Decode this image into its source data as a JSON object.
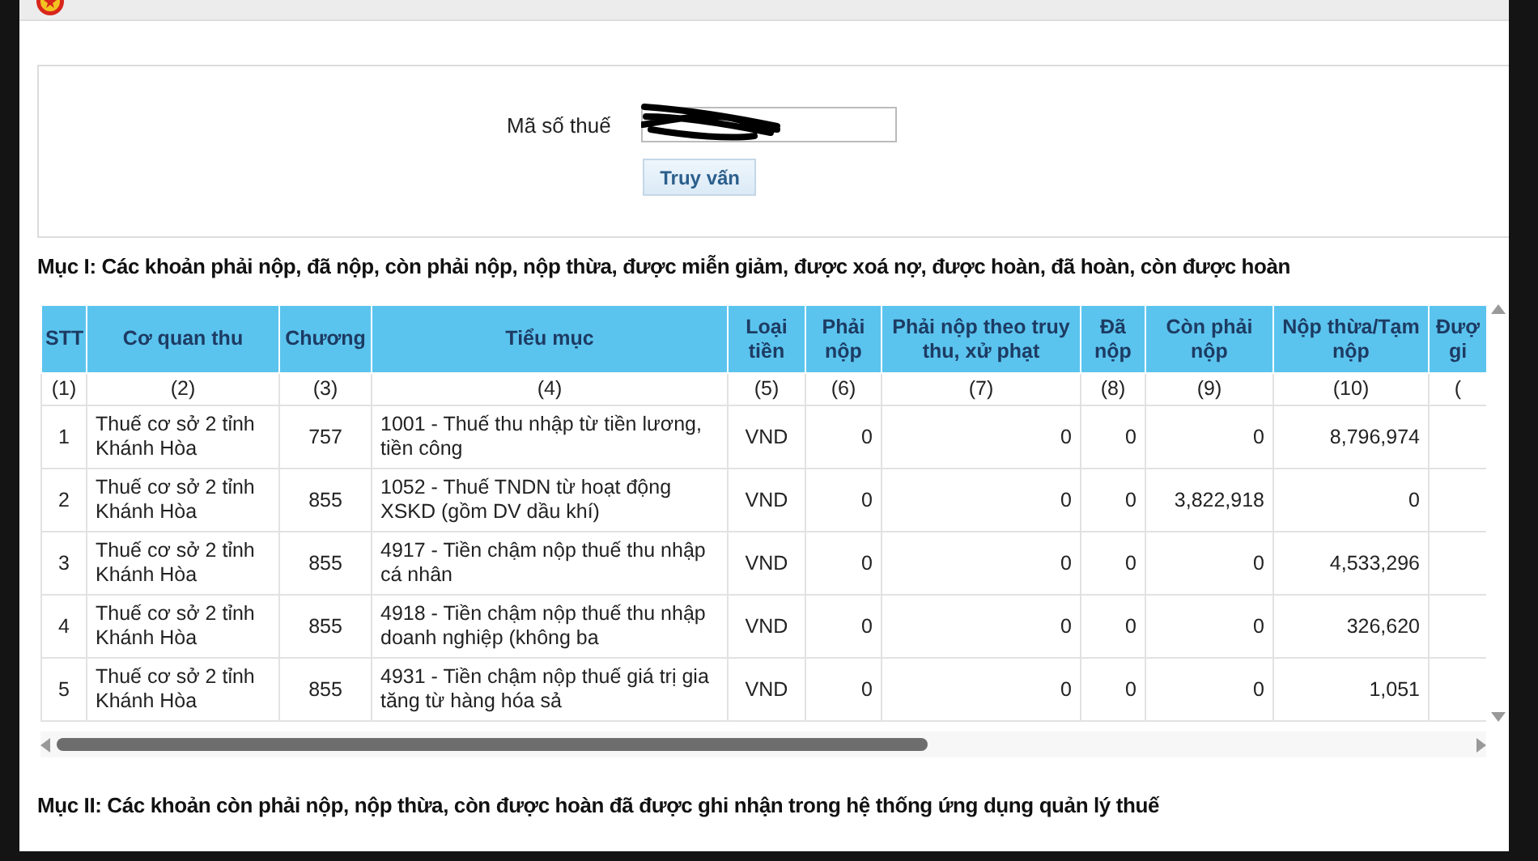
{
  "query_form": {
    "label": "Mã số thuế",
    "button": "Truy vấn"
  },
  "section_1": {
    "title": "Mục I: Các khoản phải nộp, đã nộp, còn phải nộp, nộp thừa, được miễn giảm, được xoá nợ, được hoàn, đã hoàn, còn được hoàn",
    "table": {
      "columns": [
        {
          "label": "STT",
          "number": "(1)"
        },
        {
          "label": "Cơ quan thu",
          "number": "(2)"
        },
        {
          "label": "Chương",
          "number": "(3)"
        },
        {
          "label": "Tiểu mục",
          "number": "(4)"
        },
        {
          "label": "Loại tiền",
          "number": "(5)"
        },
        {
          "label": "Phải nộp",
          "number": "(6)"
        },
        {
          "label": "Phải nộp theo truy thu, xử phạt",
          "number": "(7)"
        },
        {
          "label": "Đã nộp",
          "number": "(8)"
        },
        {
          "label": "Còn phải nộp",
          "number": "(9)"
        },
        {
          "label": "Nộp thừa/Tạm nộp",
          "number": "(10)"
        },
        {
          "label": "Đượ gi",
          "number": "("
        }
      ],
      "rows": [
        [
          "1",
          "Thuế cơ sở 2 tỉnh Khánh Hòa",
          "757",
          "1001 - Thuế thu nhập từ tiền lương, tiền công",
          "VND",
          "0",
          "0",
          "0",
          "0",
          "8,796,974"
        ],
        [
          "2",
          "Thuế cơ sở 2 tỉnh Khánh Hòa",
          "855",
          "1052 - Thuế TNDN từ hoạt động XSKD (gồm DV dầu khí)",
          "VND",
          "0",
          "0",
          "0",
          "3,822,918",
          "0"
        ],
        [
          "3",
          "Thuế cơ sở 2 tỉnh Khánh Hòa",
          "855",
          "4917 - Tiền chậm nộp thuế thu nhập cá nhân",
          "VND",
          "0",
          "0",
          "0",
          "0",
          "4,533,296"
        ],
        [
          "4",
          "Thuế cơ sở 2 tỉnh Khánh Hòa",
          "855",
          "4918 - Tiền chậm nộp thuế thu nhập doanh nghiệp (không ba",
          "VND",
          "0",
          "0",
          "0",
          "0",
          "326,620"
        ],
        [
          "5",
          "Thuế cơ sở 2 tỉnh Khánh Hòa",
          "855",
          "4931 - Tiền chậm nộp thuế giá trị gia tăng từ hàng hóa sả",
          "VND",
          "0",
          "0",
          "0",
          "0",
          "1,051"
        ]
      ]
    }
  },
  "section_2": {
    "title": "Mục II: Các khoản còn phải nộp, nộp thừa, còn được hoàn đã được ghi nhận trong hệ thống ứng dụng quản lý thuế"
  }
}
